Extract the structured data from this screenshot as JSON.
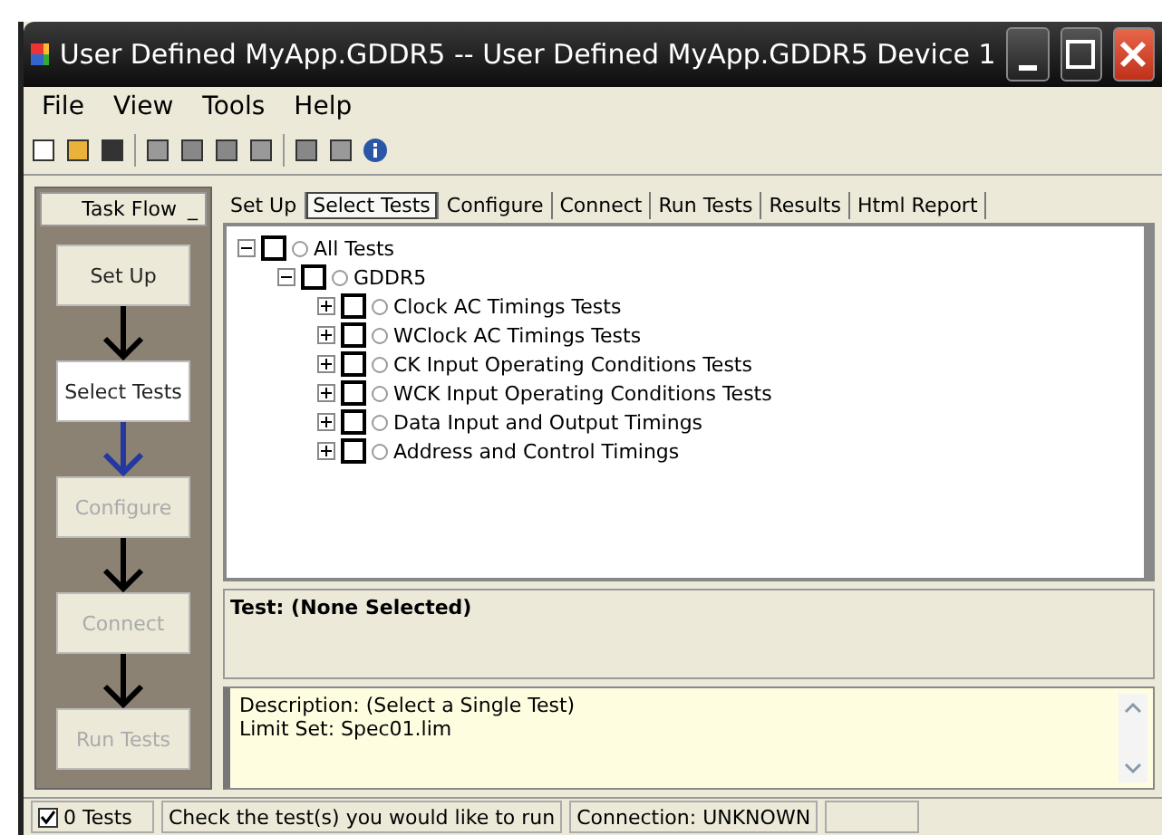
{
  "window": {
    "title": "User Defined MyApp.GDDR5 -- User Defined MyApp.GDDR5 Device 1"
  },
  "menu": [
    "File",
    "View",
    "Tools",
    "Help"
  ],
  "task_flow": {
    "title": "Task Flow",
    "minimize": "_",
    "steps": [
      {
        "label": "Set Up",
        "selected": false,
        "disabled": false
      },
      {
        "label": "Select Tests",
        "selected": true,
        "disabled": false
      },
      {
        "label": "Configure",
        "selected": false,
        "disabled": true
      },
      {
        "label": "Connect",
        "selected": false,
        "disabled": true
      },
      {
        "label": "Run Tests",
        "selected": false,
        "disabled": true
      }
    ]
  },
  "tabs": [
    {
      "label": "Set Up",
      "selected": false
    },
    {
      "label": "Select Tests",
      "selected": true
    },
    {
      "label": "Configure",
      "selected": false
    },
    {
      "label": "Connect",
      "selected": false
    },
    {
      "label": "Run Tests",
      "selected": false
    },
    {
      "label": "Results",
      "selected": false
    },
    {
      "label": "Html Report",
      "selected": false
    }
  ],
  "tree": [
    {
      "label": "All Tests",
      "checked": false,
      "expanded": true,
      "children": [
        {
          "label": "GDDR5",
          "checked": false,
          "expanded": true,
          "children": [
            {
              "label": "Clock AC Timings Tests",
              "checked": false,
              "expanded": false
            },
            {
              "label": "WClock AC Timings Tests",
              "checked": false,
              "expanded": false
            },
            {
              "label": "CK Input Operating Conditions Tests",
              "checked": false,
              "expanded": false
            },
            {
              "label": "WCK Input Operating Conditions Tests",
              "checked": false,
              "expanded": false
            },
            {
              "label": "Data Input and Output Timings",
              "checked": false,
              "expanded": false
            },
            {
              "label": "Address and Control Timings",
              "checked": false,
              "expanded": false
            }
          ]
        }
      ]
    }
  ],
  "test_header": "Test: (None Selected)",
  "description": [
    "Description: (Select a Single Test)",
    "Limit Set: Spec01.lim"
  ],
  "status_bar": {
    "all_checked": true,
    "count": "0 Tests",
    "message": "Check the test(s) you would like to run",
    "connection": "Connection: UNKNOWN"
  }
}
